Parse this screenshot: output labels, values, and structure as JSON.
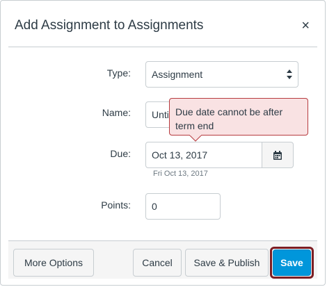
{
  "dialog": {
    "title": "Add Assignment to Assignments",
    "close_symbol": "×"
  },
  "form": {
    "type_label": "Type:",
    "type_value": "Assignment",
    "name_label": "Name:",
    "name_value": "Unti",
    "due_label": "Due:",
    "due_value": "Oct 13, 2017",
    "due_hint": "Fri Oct 13, 2017",
    "points_label": "Points:",
    "points_value": "0"
  },
  "tooltip": {
    "text": "Due date cannot be after term end"
  },
  "footer": {
    "more_options_label": "More Options",
    "cancel_label": "Cancel",
    "save_publish_label": "Save & Publish",
    "save_label": "Save"
  },
  "icons": {
    "calendar": "calendar-icon",
    "close": "close-icon",
    "select_arrows": "updown-arrows-icon"
  },
  "colors": {
    "primary": "#0096db",
    "error_bg": "#f9e2e3",
    "error_border": "#b63a3e",
    "highlight": "#7c1e24"
  }
}
